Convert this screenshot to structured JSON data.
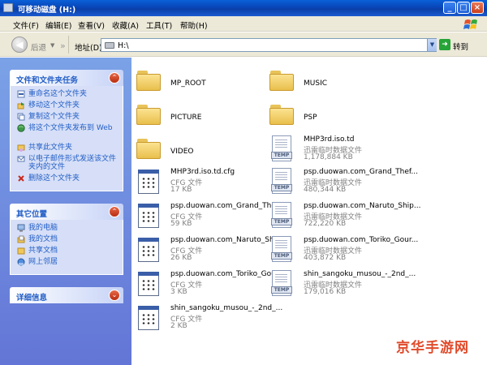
{
  "window": {
    "title": "可移动磁盘 (H:)"
  },
  "menu": [
    "文件(F)",
    "编辑(E)",
    "查看(V)",
    "收藏(A)",
    "工具(T)",
    "帮助(H)"
  ],
  "toolbar": {
    "back_label": "后退",
    "address_label": "地址(D)",
    "address_value": "H:\\",
    "go_label": "转到"
  },
  "panels": {
    "tasks": {
      "title": "文件和文件夹任务",
      "items": [
        "重命名这个文件夹",
        "移动这个文件夹",
        "复制这个文件夹",
        "将这个文件夹发布到 Web",
        "共享此文件夹",
        "以电子邮件形式发送该文件夹内的文件",
        "删除这个文件夹"
      ]
    },
    "places": {
      "title": "其它位置",
      "items": [
        "我的电脑",
        "我的文档",
        "共享文档",
        "网上邻居"
      ]
    },
    "details": {
      "title": "详细信息"
    }
  },
  "files": [
    {
      "name": "MP_ROOT",
      "kind": "folder"
    },
    {
      "name": "MUSIC",
      "kind": "folder"
    },
    {
      "name": "PICTURE",
      "kind": "folder"
    },
    {
      "name": "PSP",
      "kind": "folder"
    },
    {
      "name": "VIDEO",
      "kind": "folder"
    },
    {
      "name": "MHP3rd.iso.td",
      "type": "迅雷临时数据文件",
      "size": "1,178,884 KB",
      "kind": "temp"
    },
    {
      "name": "MHP3rd.iso.td.cfg",
      "type": "CFG 文件",
      "size": "17 KB",
      "kind": "cfg"
    },
    {
      "name": "psp.duowan.com_Grand_Thef...",
      "type": "迅雷临时数据文件",
      "size": "480,344 KB",
      "kind": "temp"
    },
    {
      "name": "psp.duowan.com_Grand_Thef...",
      "type": "CFG 文件",
      "size": "59 KB",
      "kind": "cfg"
    },
    {
      "name": "psp.duowan.com_Naruto_Ship...",
      "type": "迅雷临时数据文件",
      "size": "722,220 KB",
      "kind": "temp"
    },
    {
      "name": "psp.duowan.com_Naruto_Ship...",
      "type": "CFG 文件",
      "size": "26 KB",
      "kind": "cfg"
    },
    {
      "name": "psp.duowan.com_Toriko_Gour...",
      "type": "迅雷临时数据文件",
      "size": "403,872 KB",
      "kind": "temp"
    },
    {
      "name": "psp.duowan.com_Toriko_Gour...",
      "type": "CFG 文件",
      "size": "3 KB",
      "kind": "cfg"
    },
    {
      "name": "shin_sangoku_musou_-_2nd_...",
      "type": "迅雷临时数据文件",
      "size": "179,016 KB",
      "kind": "temp"
    },
    {
      "name": "shin_sangoku_musou_-_2nd_...",
      "type": "CFG 文件",
      "size": "2 KB",
      "kind": "cfg"
    }
  ],
  "watermark": "京华手游网"
}
